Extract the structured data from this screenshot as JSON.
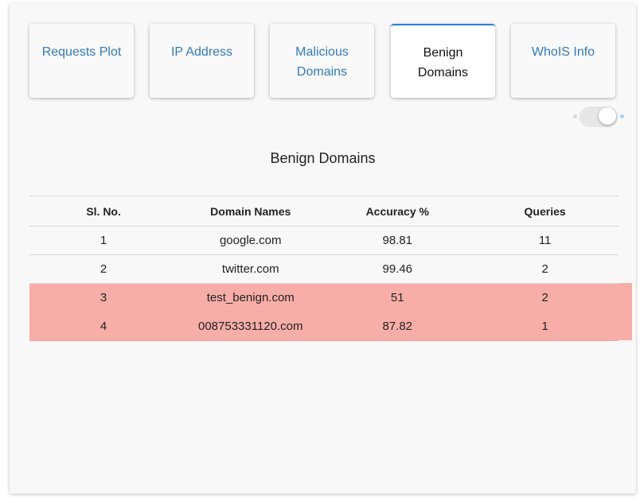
{
  "tabs": [
    {
      "label": "Requests Plot",
      "active": false
    },
    {
      "label": "IP Address",
      "active": false
    },
    {
      "label": "Malicious Domains",
      "active": false
    },
    {
      "label": "Benign Domains",
      "active": true
    },
    {
      "label": "WhoIS Info",
      "active": false
    }
  ],
  "toggle": {
    "state": "on"
  },
  "section_title": "Benign Domains",
  "table": {
    "headers": [
      "Sl. No.",
      "Domain Names",
      "Accuracy %",
      "Queries"
    ],
    "rows": [
      {
        "sl": "1",
        "domain": "google.com",
        "accuracy": "98.81",
        "queries": "11",
        "flagged": false
      },
      {
        "sl": "2",
        "domain": "twitter.com",
        "accuracy": "99.46",
        "queries": "2",
        "flagged": false
      },
      {
        "sl": "3",
        "domain": "test_benign.com",
        "accuracy": "51",
        "queries": "2",
        "flagged": true
      },
      {
        "sl": "4",
        "domain": "008753331120.com",
        "accuracy": "87.82",
        "queries": "1",
        "flagged": true
      }
    ]
  },
  "colors": {
    "tab_link": "#337ab7",
    "active_border": "#2f7ed8",
    "flagged_row": "#f8aea8"
  }
}
